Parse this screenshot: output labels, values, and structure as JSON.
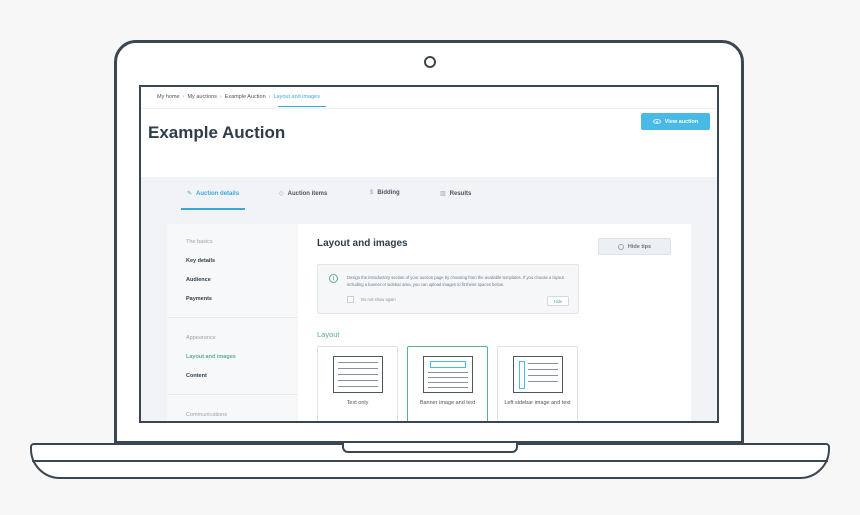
{
  "breadcrumb": {
    "items": [
      "My home",
      "My auctions",
      "Example Auction"
    ],
    "current": "Layout and images",
    "separator": "›"
  },
  "page": {
    "title": "Example Auction",
    "view_button": "View auction"
  },
  "tabs": [
    {
      "label": "Auction details",
      "icon": "✎",
      "icon_name": "pencil-icon",
      "active": true
    },
    {
      "label": "Auction items",
      "icon": "◇",
      "icon_name": "tag-icon",
      "active": false
    },
    {
      "label": "Bidding",
      "icon": "$",
      "icon_name": "dollar-icon",
      "active": false
    },
    {
      "label": "Results",
      "icon": "▥",
      "icon_name": "bar-chart-icon",
      "active": false
    }
  ],
  "sidebar": {
    "sections": [
      {
        "heading": "The basics",
        "items": [
          "Key details",
          "Audience",
          "Payments"
        ]
      },
      {
        "heading": "Appearance",
        "items": [
          "Layout and images",
          "Content"
        ],
        "active": "Layout and images"
      },
      {
        "heading": "Communications",
        "items": []
      }
    ]
  },
  "content": {
    "title": "Layout and images",
    "hide_tips": "Hide tips",
    "tip": {
      "text": "Design the introductory section of your auction page by choosing from the available templates. If you choose a layout including a banner or sidebar area, you can upload images to fit these spaces below.",
      "checkbox_label": "Do not show again",
      "hide_button": "Hide"
    },
    "layout_label": "Layout",
    "layouts": [
      {
        "label": "Text only",
        "selected": false
      },
      {
        "label": "Banner image and text",
        "selected": true
      },
      {
        "label": "Left sidebar image and text",
        "selected": false
      }
    ]
  },
  "colors": {
    "accent_blue": "#49b9e6",
    "accent_green": "#5aae91",
    "outline": "#3a4652"
  }
}
